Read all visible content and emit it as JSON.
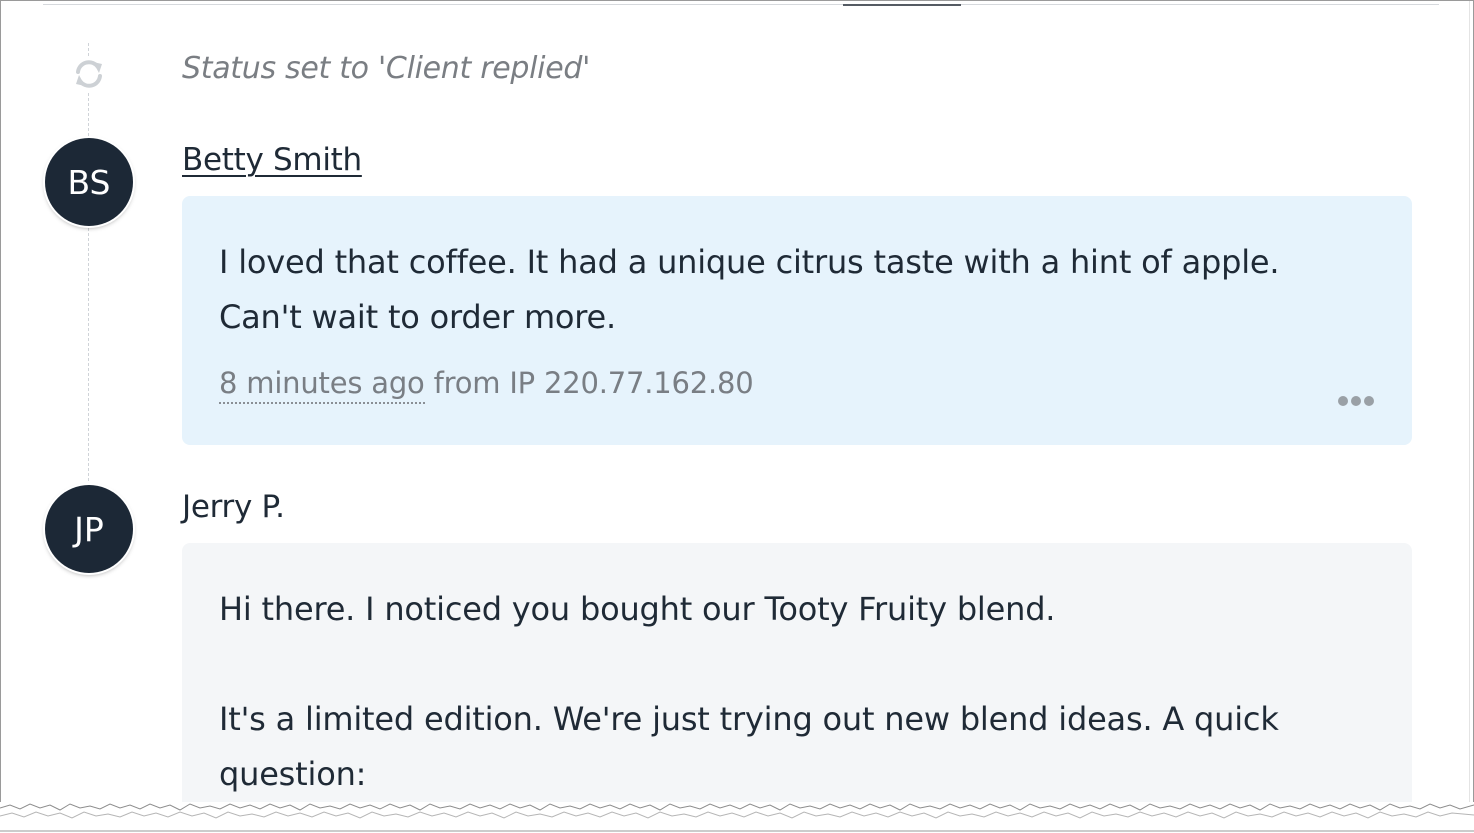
{
  "timeline": {
    "status_event": {
      "icon": "refresh-icon",
      "text": "Status set to 'Client replied'"
    },
    "messages": [
      {
        "avatar_initials": "BS",
        "author": "Betty Smith",
        "lines": [
          "I loved that coffee. It had a unique citrus taste with a hint of apple.",
          "Can't wait to order more."
        ],
        "time": "8 minutes ago",
        "ip_text": " from IP 220.77.162.80",
        "more_icon": "more-horizontal-icon",
        "bubble_color": "#e6f3fc"
      },
      {
        "avatar_initials": "JP",
        "author": "Jerry P.",
        "lines": [
          "Hi there. I noticed you bought our Tooty Fruity blend.",
          "It's a limited edition. We're just trying out new blend ideas. A quick",
          "question:"
        ],
        "bubble_color": "#f4f6f8"
      }
    ]
  },
  "colors": {
    "avatar_bg": "#1c2836",
    "text": "#1f2a36",
    "muted_text": "#7a7e83"
  }
}
